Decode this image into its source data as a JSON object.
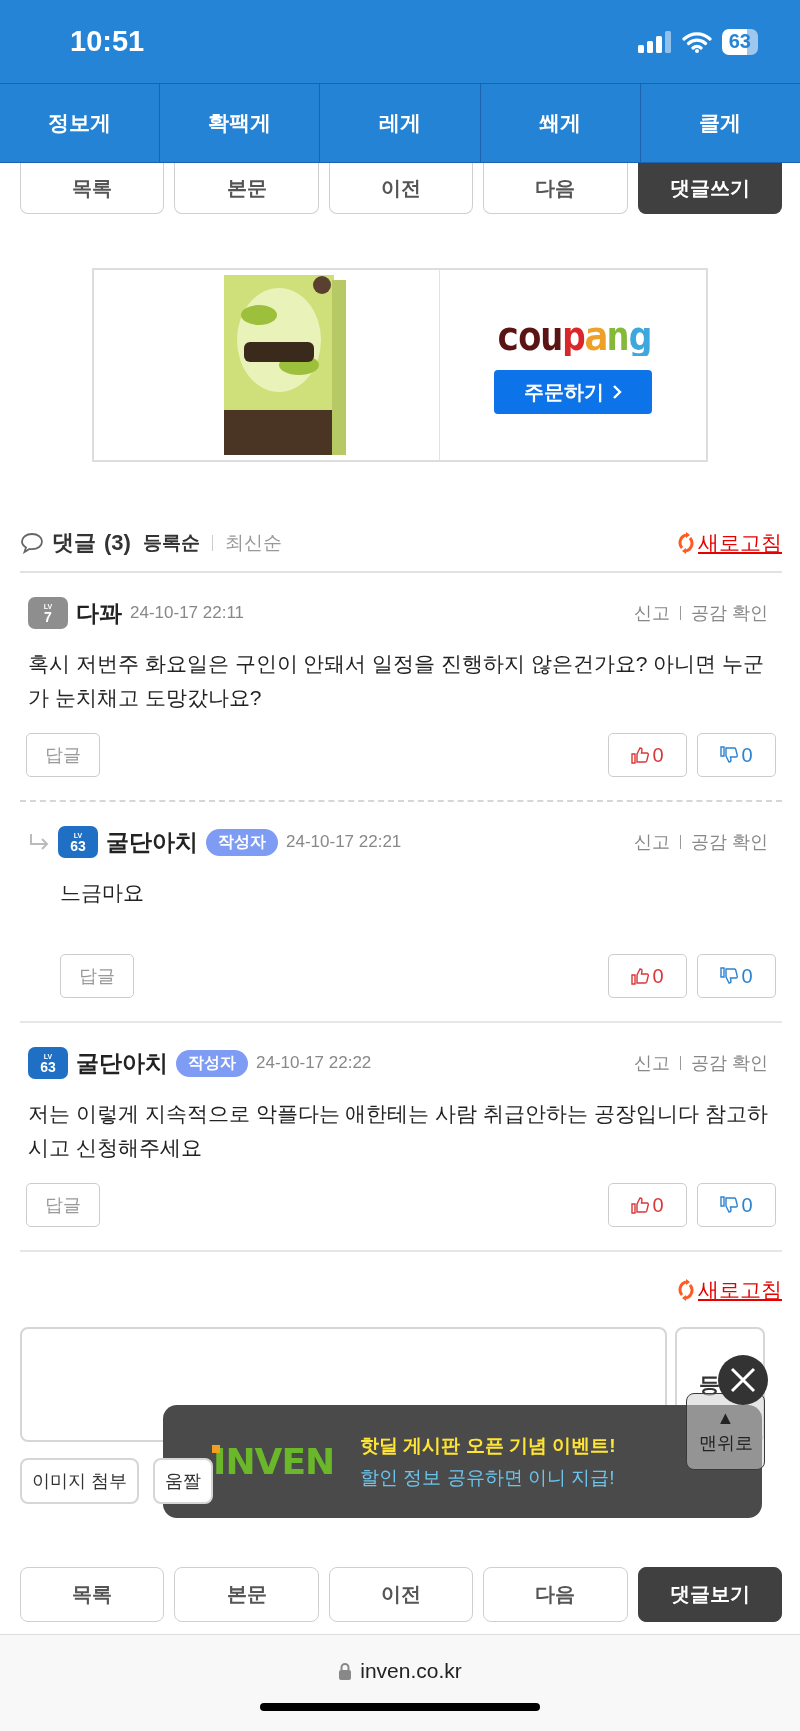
{
  "status_bar": {
    "time": "10:51",
    "battery": "63"
  },
  "board_tabs": [
    {
      "label": "정보게"
    },
    {
      "label": "확팩게"
    },
    {
      "label": "레게"
    },
    {
      "label": "쐐게"
    },
    {
      "label": "클게"
    }
  ],
  "nav_top": [
    {
      "label": "목록",
      "kind": "default"
    },
    {
      "label": "본문",
      "kind": "default"
    },
    {
      "label": "이전",
      "kind": "default"
    },
    {
      "label": "다음",
      "kind": "default"
    },
    {
      "label": "댓글쓰기",
      "kind": "primary"
    }
  ],
  "ad": {
    "brand": "coupang",
    "button": "주문하기"
  },
  "comments_header": {
    "title": "댓글",
    "count": "(3)",
    "sort": [
      {
        "label": "등록순",
        "selected": true
      },
      {
        "label": "최신순",
        "selected": false
      }
    ],
    "refresh": "새로고침"
  },
  "comments": [
    {
      "author": "다꽈",
      "level_badge": {
        "label": "LV",
        "value": "7",
        "color": "#8e8e8e"
      },
      "date": "24-10-17 22:11",
      "report": "신고",
      "like_check": "공감 확인",
      "text": "혹시 저번주 화요일은 구인이 안돼서 일정을 진행하지 않은건가요? 아니면 누군가 눈치채고 도망갔나요?",
      "reply_button": "답글",
      "likes": "0",
      "dislikes": "0",
      "children": [
        {
          "author": "굴단아치",
          "level_badge": {
            "label": "LV",
            "value": "63",
            "color": "#1f6fc4"
          },
          "author_tag": "작성자",
          "date": "24-10-17 22:21",
          "report": "신고",
          "like_check": "공감 확인",
          "text": "느금마요",
          "reply_button": "답글",
          "likes": "0",
          "dislikes": "0"
        }
      ]
    },
    {
      "author": "굴단아치",
      "level_badge": {
        "label": "LV",
        "value": "63",
        "color": "#1f6fc4"
      },
      "author_tag": "작성자",
      "date": "24-10-17 22:22",
      "report": "신고",
      "like_check": "공감 확인",
      "text": "저는 이렇게 지속적으로 악플다는 애한테는 사람 취급안하는 공장입니다 참고하시고 신청해주세요",
      "reply_button": "답글",
      "likes": "0",
      "dislikes": "0"
    }
  ],
  "refresh_bottom": "새로고침",
  "compose": {
    "submit": "등",
    "attach_image": "이미지 첨부",
    "gif": "움짤"
  },
  "nav_bottom": [
    {
      "label": "목록",
      "kind": "default"
    },
    {
      "label": "본문",
      "kind": "default"
    },
    {
      "label": "이전",
      "kind": "default"
    },
    {
      "label": "다음",
      "kind": "default"
    },
    {
      "label": "댓글보기",
      "kind": "primary"
    }
  ],
  "popup": {
    "logo": "INVEN",
    "headline": "핫딜 게시판 오픈 기념 이벤트!",
    "subline": "할인 정보 공유하면 이니 지급!"
  },
  "scroll_top": {
    "arrow": "▲",
    "label": "맨위로"
  },
  "browser": {
    "url": "inven.co.kr"
  }
}
